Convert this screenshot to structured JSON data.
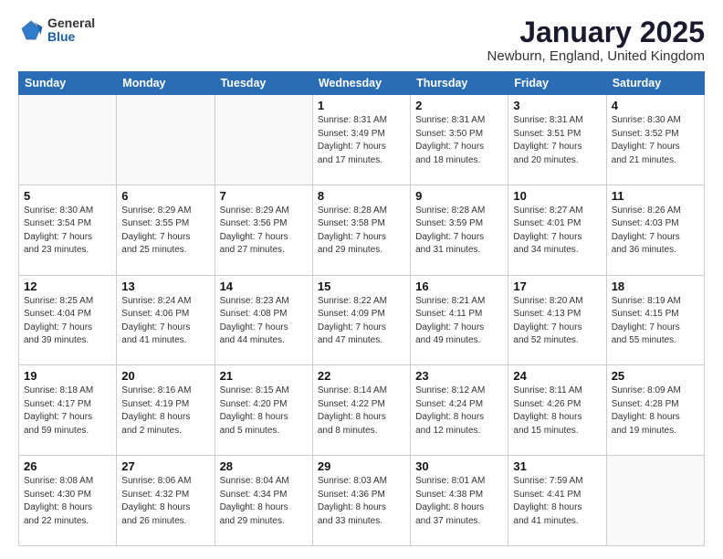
{
  "header": {
    "logo_general": "General",
    "logo_blue": "Blue",
    "title": "January 2025",
    "subtitle": "Newburn, England, United Kingdom"
  },
  "days_of_week": [
    "Sunday",
    "Monday",
    "Tuesday",
    "Wednesday",
    "Thursday",
    "Friday",
    "Saturday"
  ],
  "weeks": [
    [
      {
        "day": "",
        "info": ""
      },
      {
        "day": "",
        "info": ""
      },
      {
        "day": "",
        "info": ""
      },
      {
        "day": "1",
        "info": "Sunrise: 8:31 AM\nSunset: 3:49 PM\nDaylight: 7 hours\nand 17 minutes."
      },
      {
        "day": "2",
        "info": "Sunrise: 8:31 AM\nSunset: 3:50 PM\nDaylight: 7 hours\nand 18 minutes."
      },
      {
        "day": "3",
        "info": "Sunrise: 8:31 AM\nSunset: 3:51 PM\nDaylight: 7 hours\nand 20 minutes."
      },
      {
        "day": "4",
        "info": "Sunrise: 8:30 AM\nSunset: 3:52 PM\nDaylight: 7 hours\nand 21 minutes."
      }
    ],
    [
      {
        "day": "5",
        "info": "Sunrise: 8:30 AM\nSunset: 3:54 PM\nDaylight: 7 hours\nand 23 minutes."
      },
      {
        "day": "6",
        "info": "Sunrise: 8:29 AM\nSunset: 3:55 PM\nDaylight: 7 hours\nand 25 minutes."
      },
      {
        "day": "7",
        "info": "Sunrise: 8:29 AM\nSunset: 3:56 PM\nDaylight: 7 hours\nand 27 minutes."
      },
      {
        "day": "8",
        "info": "Sunrise: 8:28 AM\nSunset: 3:58 PM\nDaylight: 7 hours\nand 29 minutes."
      },
      {
        "day": "9",
        "info": "Sunrise: 8:28 AM\nSunset: 3:59 PM\nDaylight: 7 hours\nand 31 minutes."
      },
      {
        "day": "10",
        "info": "Sunrise: 8:27 AM\nSunset: 4:01 PM\nDaylight: 7 hours\nand 34 minutes."
      },
      {
        "day": "11",
        "info": "Sunrise: 8:26 AM\nSunset: 4:03 PM\nDaylight: 7 hours\nand 36 minutes."
      }
    ],
    [
      {
        "day": "12",
        "info": "Sunrise: 8:25 AM\nSunset: 4:04 PM\nDaylight: 7 hours\nand 39 minutes."
      },
      {
        "day": "13",
        "info": "Sunrise: 8:24 AM\nSunset: 4:06 PM\nDaylight: 7 hours\nand 41 minutes."
      },
      {
        "day": "14",
        "info": "Sunrise: 8:23 AM\nSunset: 4:08 PM\nDaylight: 7 hours\nand 44 minutes."
      },
      {
        "day": "15",
        "info": "Sunrise: 8:22 AM\nSunset: 4:09 PM\nDaylight: 7 hours\nand 47 minutes."
      },
      {
        "day": "16",
        "info": "Sunrise: 8:21 AM\nSunset: 4:11 PM\nDaylight: 7 hours\nand 49 minutes."
      },
      {
        "day": "17",
        "info": "Sunrise: 8:20 AM\nSunset: 4:13 PM\nDaylight: 7 hours\nand 52 minutes."
      },
      {
        "day": "18",
        "info": "Sunrise: 8:19 AM\nSunset: 4:15 PM\nDaylight: 7 hours\nand 55 minutes."
      }
    ],
    [
      {
        "day": "19",
        "info": "Sunrise: 8:18 AM\nSunset: 4:17 PM\nDaylight: 7 hours\nand 59 minutes."
      },
      {
        "day": "20",
        "info": "Sunrise: 8:16 AM\nSunset: 4:19 PM\nDaylight: 8 hours\nand 2 minutes."
      },
      {
        "day": "21",
        "info": "Sunrise: 8:15 AM\nSunset: 4:20 PM\nDaylight: 8 hours\nand 5 minutes."
      },
      {
        "day": "22",
        "info": "Sunrise: 8:14 AM\nSunset: 4:22 PM\nDaylight: 8 hours\nand 8 minutes."
      },
      {
        "day": "23",
        "info": "Sunrise: 8:12 AM\nSunset: 4:24 PM\nDaylight: 8 hours\nand 12 minutes."
      },
      {
        "day": "24",
        "info": "Sunrise: 8:11 AM\nSunset: 4:26 PM\nDaylight: 8 hours\nand 15 minutes."
      },
      {
        "day": "25",
        "info": "Sunrise: 8:09 AM\nSunset: 4:28 PM\nDaylight: 8 hours\nand 19 minutes."
      }
    ],
    [
      {
        "day": "26",
        "info": "Sunrise: 8:08 AM\nSunset: 4:30 PM\nDaylight: 8 hours\nand 22 minutes."
      },
      {
        "day": "27",
        "info": "Sunrise: 8:06 AM\nSunset: 4:32 PM\nDaylight: 8 hours\nand 26 minutes."
      },
      {
        "day": "28",
        "info": "Sunrise: 8:04 AM\nSunset: 4:34 PM\nDaylight: 8 hours\nand 29 minutes."
      },
      {
        "day": "29",
        "info": "Sunrise: 8:03 AM\nSunset: 4:36 PM\nDaylight: 8 hours\nand 33 minutes."
      },
      {
        "day": "30",
        "info": "Sunrise: 8:01 AM\nSunset: 4:38 PM\nDaylight: 8 hours\nand 37 minutes."
      },
      {
        "day": "31",
        "info": "Sunrise: 7:59 AM\nSunset: 4:41 PM\nDaylight: 8 hours\nand 41 minutes."
      },
      {
        "day": "",
        "info": ""
      }
    ]
  ]
}
